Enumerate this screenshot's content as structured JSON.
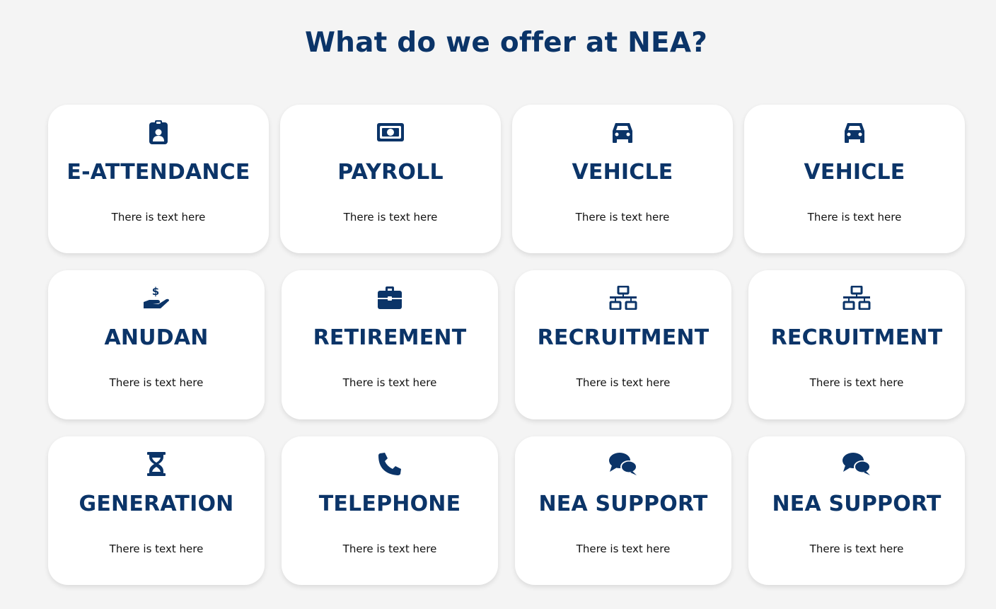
{
  "page": {
    "title": "What do we offer at NEA?"
  },
  "services": [
    {
      "name": "E-ATTENDANCE",
      "description": "There is text here",
      "icon": "id-badge-icon"
    },
    {
      "name": "PAYROLL",
      "description": "There is text here",
      "icon": "money-bill-icon"
    },
    {
      "name": "VEHICLE",
      "description": "There is text here",
      "icon": "car-icon"
    },
    {
      "name": "VEHICLE",
      "description": "There is text here",
      "icon": "car-icon"
    },
    {
      "name": "ANUDAN",
      "description": "There is text here",
      "icon": "hand-holding-dollar-icon"
    },
    {
      "name": "RETIREMENT",
      "description": "There is text here",
      "icon": "briefcase-icon"
    },
    {
      "name": "RECRUITMENT",
      "description": "There is text here",
      "icon": "network-icon"
    },
    {
      "name": "RECRUITMENT",
      "description": "There is text here",
      "icon": "network-icon"
    },
    {
      "name": "GENERATION",
      "description": "There is text here",
      "icon": "hourglass-icon"
    },
    {
      "name": "TELEPHONE",
      "description": "There is text here",
      "icon": "phone-icon"
    },
    {
      "name": "NEA SUPPORT",
      "description": "There is text here",
      "icon": "comments-icon"
    },
    {
      "name": "NEA SUPPORT",
      "description": "There is text here",
      "icon": "comments-icon"
    }
  ],
  "colors": {
    "brand": "#0b3468",
    "background": "#f4f4f4",
    "card": "#ffffff",
    "text": "#111111"
  }
}
